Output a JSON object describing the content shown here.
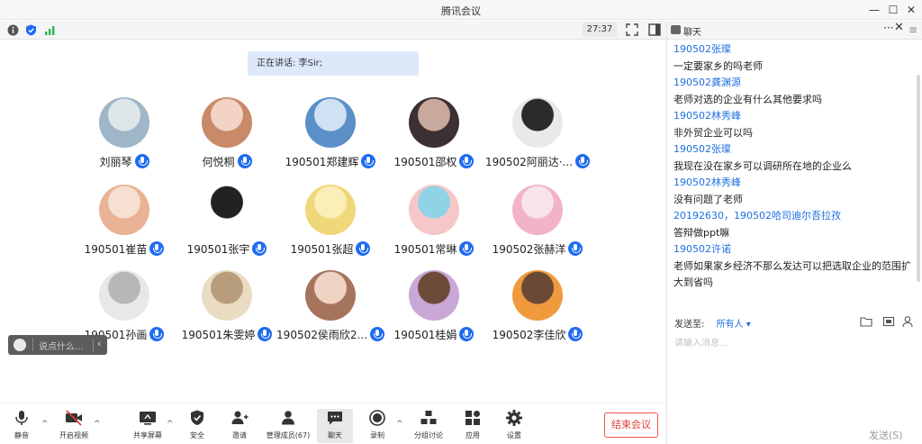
{
  "window": {
    "title": "腾讯会议"
  },
  "topbar": {
    "timer": "27:37"
  },
  "speaking": "正在讲话: 李Sir;",
  "participants": [
    {
      "name": "刘丽琴"
    },
    {
      "name": "何悦桐"
    },
    {
      "name": "190501郑建辉"
    },
    {
      "name": "190501邵权"
    },
    {
      "name": "190502阿丽达·..."
    },
    {
      "name": "190501崔苗"
    },
    {
      "name": "190501张宇"
    },
    {
      "name": "190501张超"
    },
    {
      "name": "190501常琳"
    },
    {
      "name": "190502张赫洋"
    },
    {
      "name": "190501孙画"
    },
    {
      "name": "190501朱雯婷"
    },
    {
      "name": "190502侯雨欣2..."
    },
    {
      "name": "190501桂娟"
    },
    {
      "name": "190502李佳欣"
    }
  ],
  "reaction_bar": {
    "placeholder": "说点什么..."
  },
  "toolbar": {
    "mute": "静音",
    "video": "开启视频",
    "share": "共享屏幕",
    "security": "安全",
    "invite": "邀请",
    "members": "管理成员(67)",
    "chat": "聊天",
    "record": "录制",
    "breakout": "分组讨论",
    "apps": "应用",
    "settings": "设置",
    "end": "结束会议"
  },
  "chat": {
    "title": "聊天",
    "messages": [
      {
        "sender": "190502张璨",
        "text": "一定要家乡的吗老师"
      },
      {
        "sender": "190502龚渊源",
        "text": "老师对选的企业有什么其他要求吗"
      },
      {
        "sender": "190502林秀峰",
        "text": "非外贸企业可以吗"
      },
      {
        "sender": "190502张璨",
        "text": "我现在没在家乡可以调研所在地的企业么"
      },
      {
        "sender": "190502林秀峰",
        "text": "没有问题了老师"
      },
      {
        "sender": "20192630，190502哈司迪尔吾拉孜",
        "text": "答辩做ppt嘛"
      },
      {
        "sender": "190502许诺",
        "text": "老师如果家乡经济不那么发达可以把选取企业的范围扩大到省吗"
      }
    ],
    "send_to_label": "发送至:",
    "send_to_value": "所有人",
    "input_placeholder": "请输入消息...",
    "send_label": "发送(S)"
  },
  "colors": {
    "accent": "#1e6cf2",
    "end_red": "#e23b3b",
    "sender_blue": "#1f6fe0"
  }
}
